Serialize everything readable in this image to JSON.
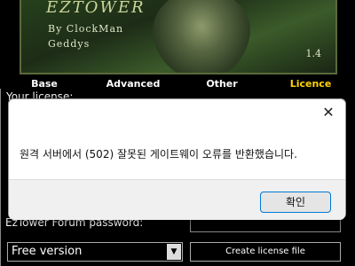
{
  "banner": {
    "title": "EZTOWER",
    "by_line_1": "By ClockMan",
    "by_line_2": "Geddys",
    "version": "1.4"
  },
  "tabs": [
    {
      "label": "Base"
    },
    {
      "label": "Advanced"
    },
    {
      "label": "Other"
    },
    {
      "label": "Licence",
      "active": true
    }
  ],
  "content": {
    "license_label": "Your license:",
    "password_label": "EzTower Forum password:",
    "version_select": {
      "selected": "Free version"
    },
    "create_button": "Create license file"
  },
  "dialog": {
    "message": "원격 서버에서 (502) 잘못된 게이트웨이 오류를 반환했습니다.",
    "ok_label": "확인",
    "close_icon": "close-icon"
  },
  "colors": {
    "active_tab": "#ffd400",
    "dialog_button_border": "#0078d7"
  }
}
